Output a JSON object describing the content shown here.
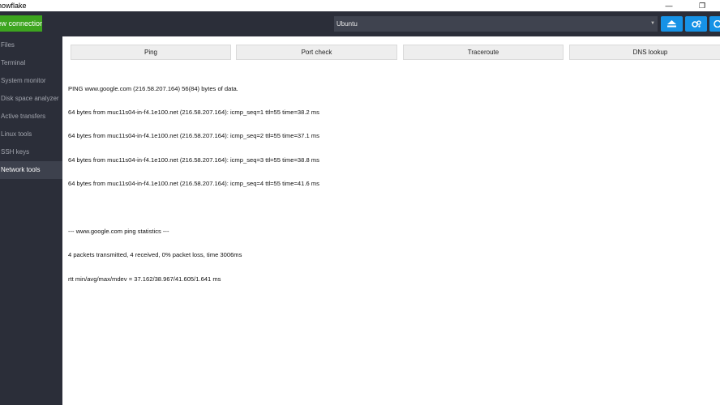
{
  "window": {
    "title": "nowflake",
    "minimize_glyph": "—",
    "maximize_glyph": "❐"
  },
  "toolbar": {
    "new_connection_label": "New connection",
    "session_selected": "Ubuntu",
    "icons": [
      "eject-icon",
      "settings-icon",
      "info-icon"
    ],
    "accent_color": "#1692e6",
    "new_connection_color": "#3da51f"
  },
  "sidebar": {
    "items": [
      {
        "label": "Files"
      },
      {
        "label": "Terminal"
      },
      {
        "label": "System monitor"
      },
      {
        "label": "Disk space analyzer"
      },
      {
        "label": "Active transfers"
      },
      {
        "label": "Linux tools"
      },
      {
        "label": "SSH keys"
      },
      {
        "label": "Network tools"
      }
    ],
    "active_index": 7
  },
  "tools": {
    "ping": "Ping",
    "port_check": "Port check",
    "traceroute": "Traceroute",
    "dns_lookup": "DNS lookup"
  },
  "output": {
    "lines": [
      "PING www.google.com (216.58.207.164) 56(84) bytes of data.",
      "64 bytes from muc11s04-in-f4.1e100.net (216.58.207.164): icmp_seq=1 ttl=55 time=38.2 ms",
      "64 bytes from muc11s04-in-f4.1e100.net (216.58.207.164): icmp_seq=2 ttl=55 time=37.1 ms",
      "64 bytes from muc11s04-in-f4.1e100.net (216.58.207.164): icmp_seq=3 ttl=55 time=38.8 ms",
      "64 bytes from muc11s04-in-f4.1e100.net (216.58.207.164): icmp_seq=4 ttl=55 time=41.6 ms",
      "",
      "--- www.google.com ping statistics ---",
      "4 packets transmitted, 4 received, 0% packet loss, time 3006ms",
      "rtt min/avg/max/mdev = 37.162/38.967/41.605/1.641 ms"
    ]
  }
}
